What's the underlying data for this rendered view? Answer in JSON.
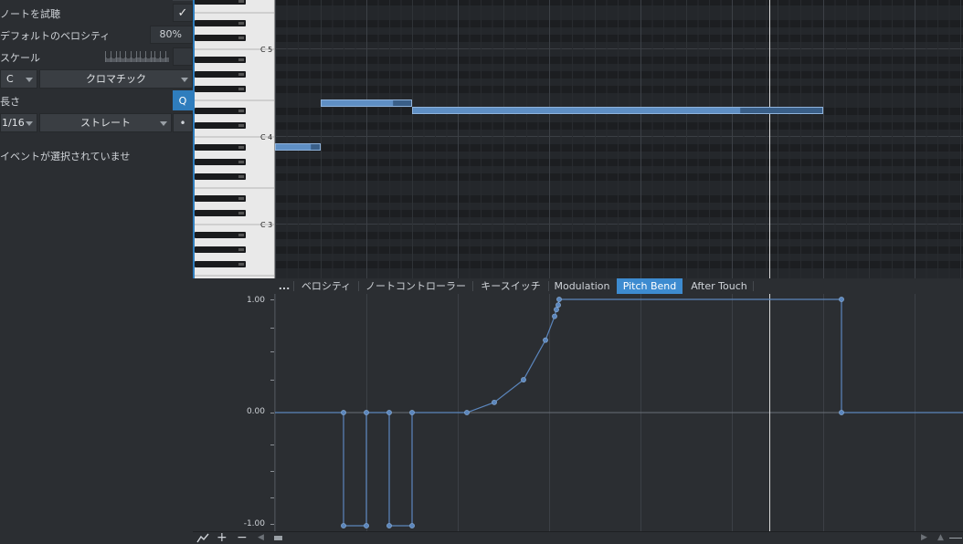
{
  "inspector": {
    "preview_notes_label": "ノートを試聴",
    "preview_notes_checked": true,
    "default_velocity_label": "デフォルトのベロシティ",
    "default_velocity_value": "80%",
    "scale_label": "スケール",
    "scale_root": "C",
    "scale_type": "クロマチック",
    "length_label": "長さ",
    "quantize_button": "Q",
    "quantize_value": "1/16",
    "quantize_mode": "ストレート",
    "dot_button": "•",
    "no_event_text": "イベントが選択されていませ"
  },
  "keyboard": {
    "octave_labels": [
      "C 5",
      "C 4",
      "C 3"
    ]
  },
  "tabs": {
    "more": "...",
    "items": [
      "ベロシティ",
      "ノートコントローラー",
      "キースイッチ",
      "Modulation",
      "Pitch Bend",
      "After Touch"
    ],
    "active_index": 4
  },
  "automation": {
    "parameter": "Pitch Bend",
    "y_labels": [
      "1.00",
      "0.00",
      "-1.00"
    ]
  },
  "bottom_bar": {
    "curve_icon": "automation-curve-icon",
    "add_icon": "plus-icon",
    "remove_icon": "minus-icon"
  },
  "colors": {
    "accent": "#3d8bd0",
    "note_fill": "#4f7db0",
    "curve": "#5b86bd"
  }
}
